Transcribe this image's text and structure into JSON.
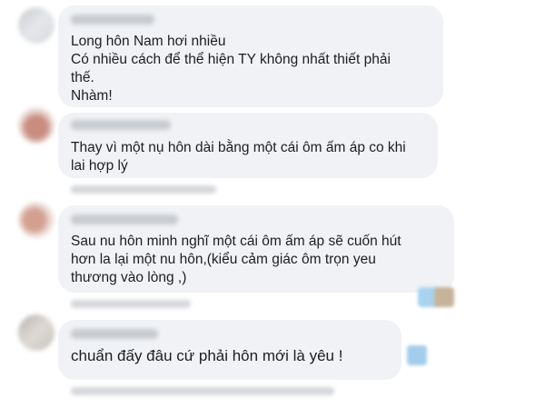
{
  "comments": [
    {
      "lines": [
        "Long hôn Nam hơi nhiều",
        "Có nhiều cách để thể hiện TY không nhất thiết phải",
        "thế.",
        "Nhàm!"
      ]
    },
    {
      "lines": [
        "Thay vì một nụ hôn dài bằng một cái ôm ấm áp co khi",
        "lai hợp lý"
      ]
    },
    {
      "lines": [
        "Sau nu hôn minh nghĩ một cái ôm ấm áp sẽ cuốn hút",
        "hơn la lại một nu hôn,(kiểu cảm giác ôm trọn yeu",
        "thương vào lòng ,)"
      ]
    },
    {
      "lines": [
        "chuẩn đấy đâu cứ phải hôn mới là yêu !"
      ]
    }
  ]
}
